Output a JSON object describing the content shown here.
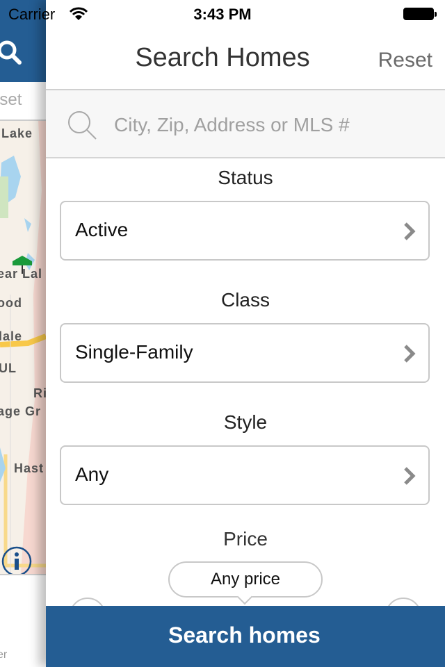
{
  "status_bar": {
    "carrier": "Carrier",
    "time": "3:43 PM",
    "wifi_icon": "wifi-icon",
    "battery_icon": "battery-icon"
  },
  "background_map": {
    "reset_label": "eset",
    "labels": [
      "Lake",
      "ear Lal",
      "ood",
      "lale",
      "UL",
      "Ri",
      "age Gr",
      "Hast"
    ],
    "bottom_text": "er",
    "header_color": "#245d93",
    "pin_color": "#1a9a3a"
  },
  "nav": {
    "title": "Search Homes",
    "reset_label": "Reset"
  },
  "search": {
    "placeholder": "City, Zip, Address or MLS #",
    "value": ""
  },
  "filters": [
    {
      "label": "Status",
      "value": "Active"
    },
    {
      "label": "Class",
      "value": "Single-Family"
    },
    {
      "label": "Style",
      "value": "Any"
    }
  ],
  "price": {
    "label": "Price",
    "value": "Any price"
  },
  "footer": {
    "search_button_label": "Search homes"
  },
  "colors": {
    "brand": "#245d93",
    "chevron": "#8a8a8a",
    "border": "#c8c8c8"
  }
}
